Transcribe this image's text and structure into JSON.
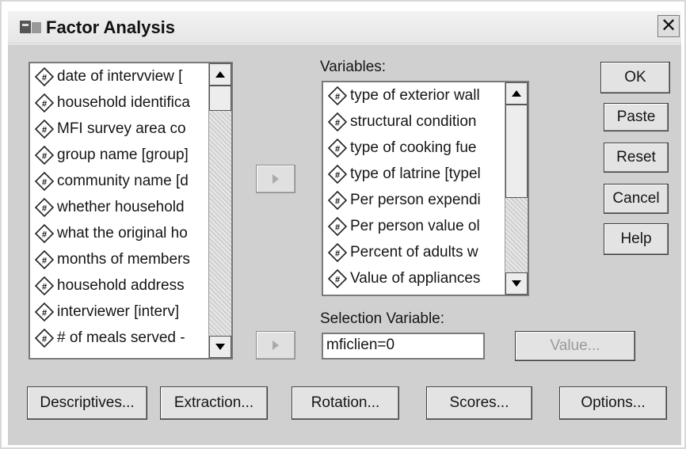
{
  "window": {
    "title": "Factor Analysis",
    "close_label": "✕"
  },
  "source_list": {
    "items": [
      "date of intervview [",
      "household identifica",
      "MFI survey area co",
      "group name [group]",
      "community name [d",
      "whether household",
      "what the original ho",
      "months of members",
      "household address",
      "interviewer [interv]",
      "# of meals served -"
    ]
  },
  "variables": {
    "label": "Variables:",
    "items": [
      "type of exterior wall",
      "structural condition",
      "type of cooking fue",
      "type of latrine [typel",
      "Per person expendi",
      "Per person value ol",
      "Percent of adults w",
      "Value of appliances"
    ]
  },
  "selection": {
    "label": "Selection Variable:",
    "value": "mficlien=0",
    "value_button": "Value..."
  },
  "side_buttons": {
    "ok": "OK",
    "paste": "Paste",
    "reset": "Reset",
    "cancel": "Cancel",
    "help": "Help"
  },
  "bottom_buttons": {
    "descriptives": "Descriptives...",
    "extraction": "Extraction...",
    "rotation": "Rotation...",
    "scores": "Scores...",
    "options": "Options..."
  },
  "icons": {
    "variable": "numeric-variable-icon",
    "move": "right-arrow-icon"
  },
  "colors": {
    "dialog_bg": "#d0d0d0",
    "list_bg": "#ffffff",
    "border": "#7a7a7a"
  }
}
